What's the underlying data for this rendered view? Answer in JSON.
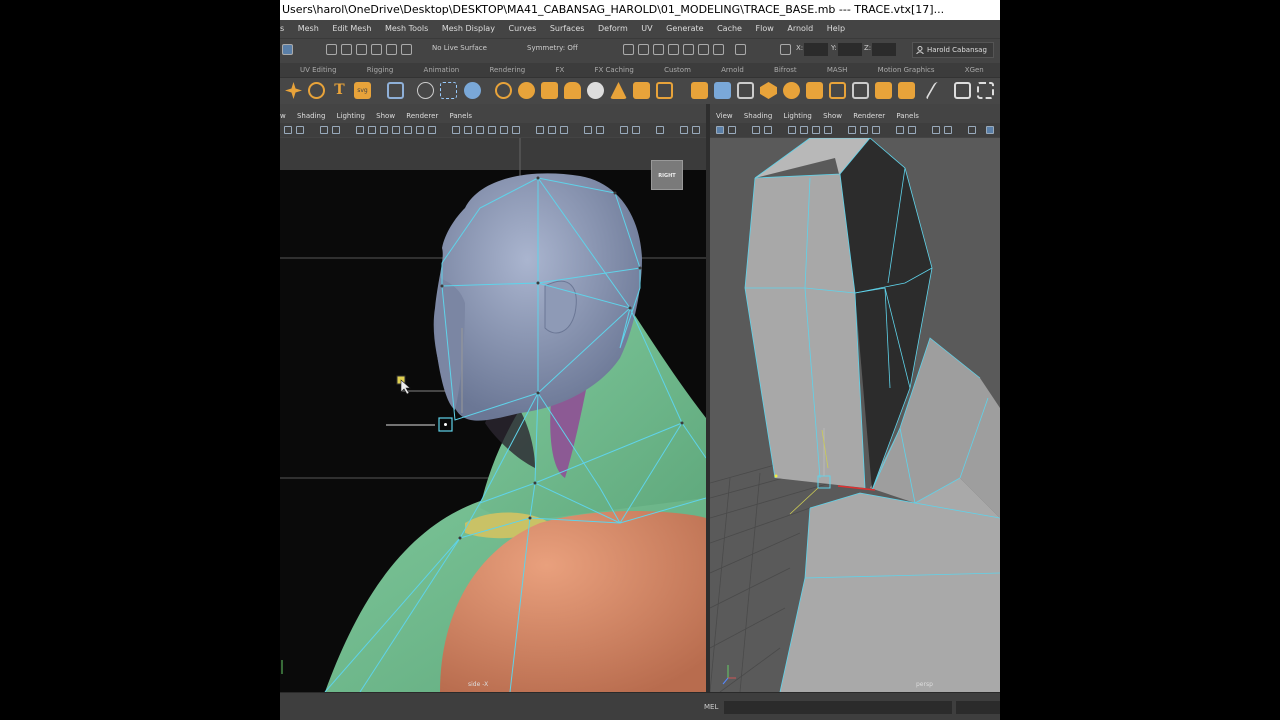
{
  "window": {
    "title": "Users\\harol\\OneDrive\\Desktop\\DESKTOP\\MA41_CABANSAG_HAROLD\\01_MODELING\\TRACE_BASE.mb  ---  TRACE.vtx[17]..."
  },
  "menubar": [
    "s",
    "Mesh",
    "Edit Mesh",
    "Mesh Tools",
    "Mesh Display",
    "Curves",
    "Surfaces",
    "Deform",
    "UV",
    "Generate",
    "Cache",
    "Flow",
    "Arnold",
    "Help"
  ],
  "statusline": {
    "live_surface": "No Live Surface",
    "symmetry": "Symmetry: Off",
    "x_label": "X:",
    "y_label": "Y:",
    "z_label": "Z:",
    "user": "Harold Cabansag"
  },
  "shelf_tabs": [
    "UV Editing",
    "Rigging",
    "Animation",
    "Rendering",
    "FX",
    "FX Caching",
    "Custom",
    "Arnold",
    "Bifrost",
    "MASH",
    "Motion Graphics",
    "XGen"
  ],
  "viewport_left": {
    "menus": [
      "w",
      "Shading",
      "Lighting",
      "Show",
      "Renderer",
      "Panels"
    ],
    "camera": "side -X",
    "view_cube": "RIGHT"
  },
  "viewport_right": {
    "menus": [
      "View",
      "Shading",
      "Lighting",
      "Show",
      "Renderer",
      "Panels"
    ],
    "camera": "persp"
  },
  "command_line": {
    "label": "MEL"
  },
  "colors": {
    "skin_blue": "#8a97b5",
    "neck_green": "#6fba8c",
    "muscle_purple": "#8c5a94",
    "torso_orange": "#d98a68",
    "collar_yellow": "#c9c266",
    "wire_cyan": "#5fd3ea",
    "persp_mesh": "#a9a9a9"
  },
  "icons": [
    "window-close-icon",
    "select-tool-icon",
    "snap-icon",
    "magnet-icon",
    "user-icon",
    "polygon-cube-icon",
    "text-icon",
    "svg-icon"
  ]
}
